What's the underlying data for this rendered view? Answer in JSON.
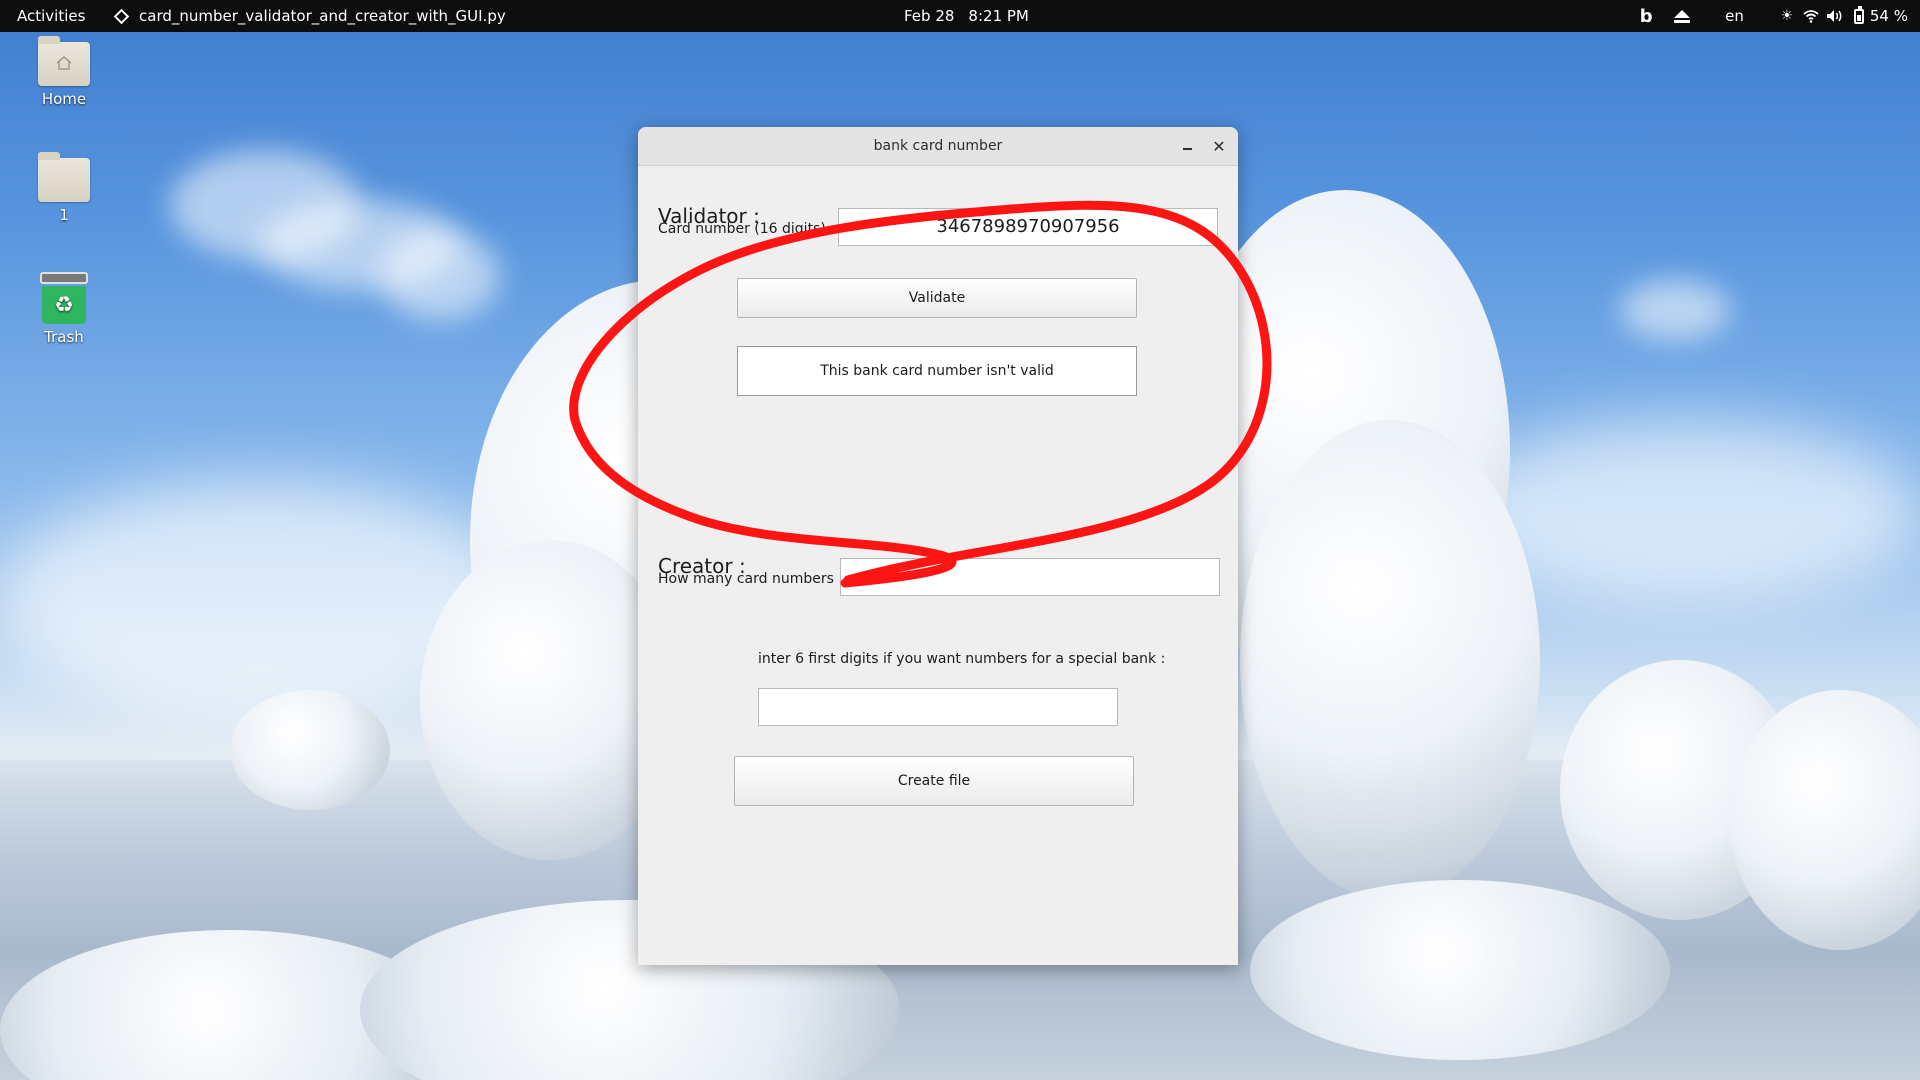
{
  "topbar": {
    "activities": "Activities",
    "app_name": "card_number_validator_and_creator_with_GUI.py",
    "date": "Feb 28",
    "time": "8:21 PM",
    "language": "en",
    "battery": "54 %",
    "icons": [
      "bing-icon",
      "eject-icon",
      "brightness-icon",
      "wifi-icon",
      "volume-icon",
      "battery-icon"
    ]
  },
  "desktop": {
    "icons": [
      {
        "label": "Home",
        "icon": "home-folder-icon"
      },
      {
        "label": "1",
        "icon": "folder-icon"
      },
      {
        "label": "Trash",
        "icon": "trash-icon"
      }
    ]
  },
  "window": {
    "title": "bank card number",
    "validator": {
      "heading": "Validator :",
      "card_label": "Card number (16 digits) :",
      "card_value": "3467898970907956",
      "validate_button": "Validate",
      "result_text": "This bank card number isn't valid"
    },
    "creator": {
      "heading": "Creator :",
      "count_label": "How many card numbers :",
      "count_value": "",
      "prefix_label": "inter 6 first digits if you want numbers for a special bank :",
      "prefix_value": "",
      "create_button": "Create file"
    }
  },
  "annotation": {
    "color": "#ff1a1a",
    "shape": "hand-drawn loop around validator section"
  }
}
